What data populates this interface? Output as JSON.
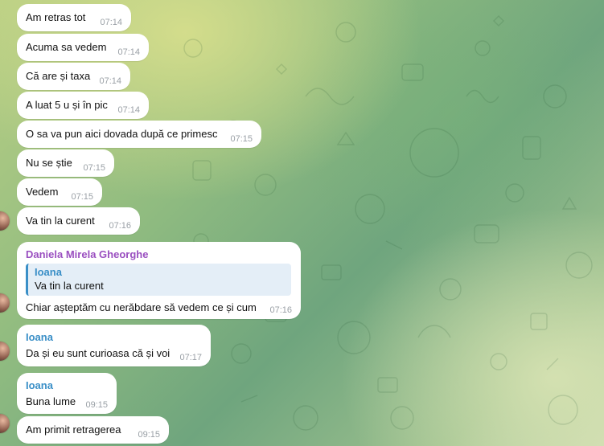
{
  "messages": [
    {
      "text": "Am retras tot",
      "time": "07:14"
    },
    {
      "text": "Acuma sa vedem",
      "time": "07:14"
    },
    {
      "text": "Că are și taxa",
      "time": "07:14"
    },
    {
      "text": "A luat 5 u și în pic",
      "time": "07:14"
    },
    {
      "text": "O sa va pun aici dovada după ce primesc",
      "time": "07:15"
    },
    {
      "text": "Nu se știe",
      "time": "07:15"
    },
    {
      "text": "Vedem",
      "time": "07:15"
    },
    {
      "text": "Va tin la curent",
      "time": "07:16"
    }
  ],
  "reply_message": {
    "sender": "Daniela Mirela Gheorghe",
    "quoted_sender": "Ioana",
    "quoted_text": "Va tin la curent",
    "text": "Chiar așteptăm cu nerăbdare să vedem ce și cum",
    "time": "07:16"
  },
  "ioana_message_1": {
    "sender": "Ioana",
    "text": "Da și eu sunt curioasa că și voi",
    "time": "07:17"
  },
  "ioana_message_2": {
    "sender": "Ioana",
    "text": "Buna lume",
    "time": "09:15"
  },
  "last_message": {
    "text": "Am primit  retragerea",
    "time": "09:15"
  },
  "colors": {
    "bubble": "#ffffff",
    "daniela_name": "#9a4fc0",
    "ioana_name": "#3a8fc7",
    "time": "#9aa0a6",
    "reply_bg": "#e4eef7"
  }
}
